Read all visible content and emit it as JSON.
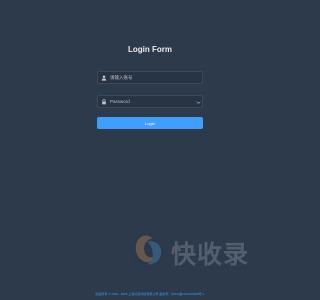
{
  "login_form": {
    "title": "Login Form",
    "username_placeholder": "请输入账号",
    "password_placeholder": "Password",
    "login_label": "Login"
  },
  "icons": {
    "username": "user-icon",
    "password": "lock-icon",
    "toggle": "eye-icon"
  },
  "watermark": {
    "logo": "brand-logo",
    "text": "快收录"
  },
  "footer": {
    "text": "版权所有 © 2020 - 2025 上海点墨科技有限公司 备案号：沪ICP备2023010458号-1"
  },
  "colors": {
    "background": "#2d3a4b",
    "accent": "#409eff"
  }
}
